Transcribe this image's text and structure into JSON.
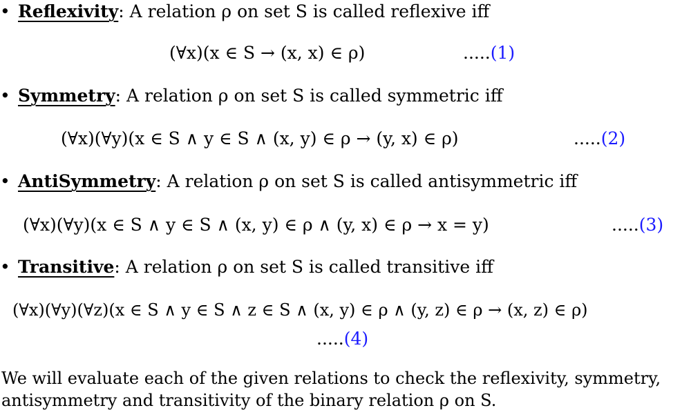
{
  "definitions": [
    {
      "term": "Reflexivity",
      "text": ": A relation ρ on set S is called reflexive iff",
      "formula": "(∀x)(x ∈ S → (x, x) ∈ ρ)",
      "dots": ".....",
      "ref": "(1)"
    },
    {
      "term": "Symmetry",
      "text": ": A relation ρ on set S is called symmetric iff",
      "formula": "(∀x)(∀y)(x ∈ S ∧ y ∈ S ∧ (x, y) ∈ ρ → (y, x) ∈ ρ)",
      "dots": ".....",
      "ref": "(2)"
    },
    {
      "term": "AntiSymmetry",
      "text": ": A relation ρ on set S is called antisymmetric iff",
      "formula": "(∀x)(∀y)(x ∈ S ∧ y ∈ S ∧ (x, y) ∈ ρ ∧ (y, x) ∈ ρ → x = y)",
      "dots": ".....",
      "ref": "(3)"
    },
    {
      "term": "Transitive",
      "text": ": A relation ρ on set S is called transitive iff",
      "formula": "(∀x)(∀y)(∀z)(x ∈ S ∧ y ∈ S ∧ z ∈ S ∧ (x, y) ∈ ρ ∧ (y, z) ∈ ρ → (x, z) ∈ ρ)",
      "dots": ".....",
      "ref": "(4)"
    }
  ],
  "bullet": "•",
  "conclusion": {
    "line1": "We will evaluate each of the given relations to check the reflexivity, symmetry,",
    "line2": "antisymmetry and transitivity of the binary relation ρ on S."
  }
}
